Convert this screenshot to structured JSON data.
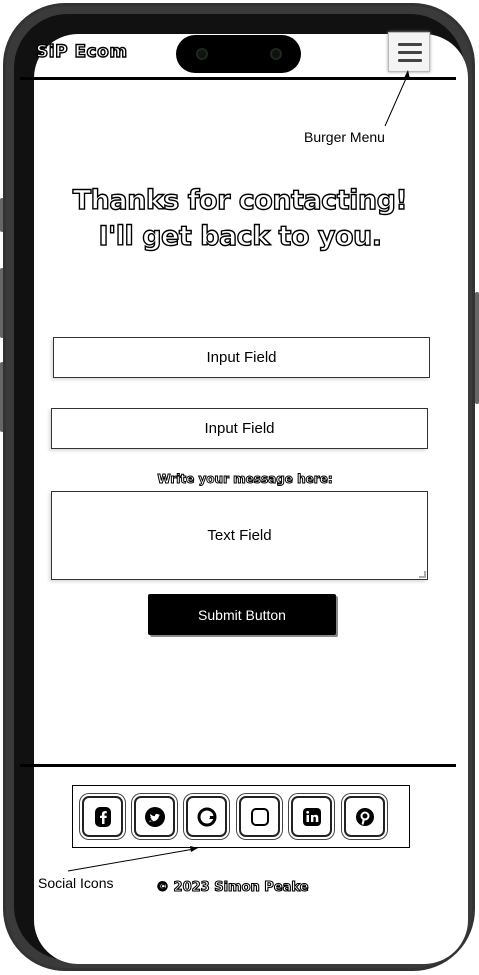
{
  "header": {
    "logo_text": "SiP Ecom",
    "burger_icon": "hamburger-menu-icon"
  },
  "annotations": {
    "burger_menu": "Burger Menu",
    "social_icons": "Social Icons"
  },
  "main": {
    "heading_line1": "Thanks for contacting!",
    "heading_line2": "I'll get back to you.",
    "input_field_1": "Input Field",
    "input_field_2": "Input Field",
    "message_label": "Write your message here:",
    "text_field": "Text Field",
    "submit_label": "Submit Button"
  },
  "footer": {
    "social_icons": [
      "facebook-icon",
      "twitter-icon",
      "google-icon",
      "instagram-icon",
      "linkedin-icon",
      "pinterest-icon"
    ],
    "copyright": "© 2023 Simon Peake"
  }
}
